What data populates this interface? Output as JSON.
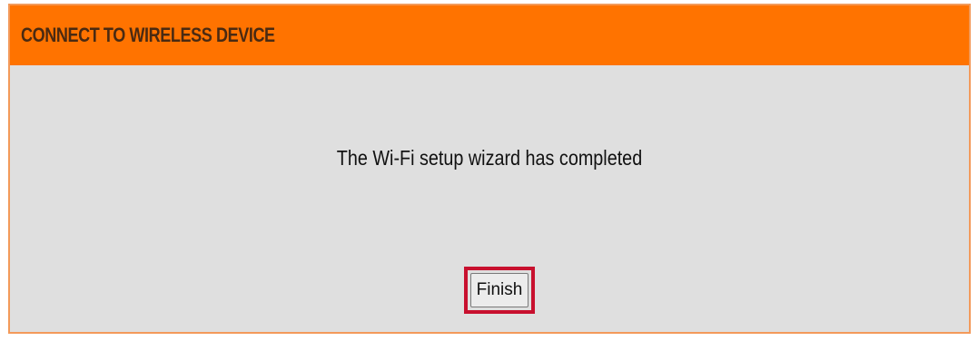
{
  "panel": {
    "title": "CONNECT TO WIRELESS DEVICE",
    "message": "The Wi-Fi setup wizard has completed",
    "finish_label": "Finish"
  },
  "colors": {
    "header": "#ff7300",
    "panel_background": "#dfdfdf",
    "highlight": "#c8102e"
  }
}
